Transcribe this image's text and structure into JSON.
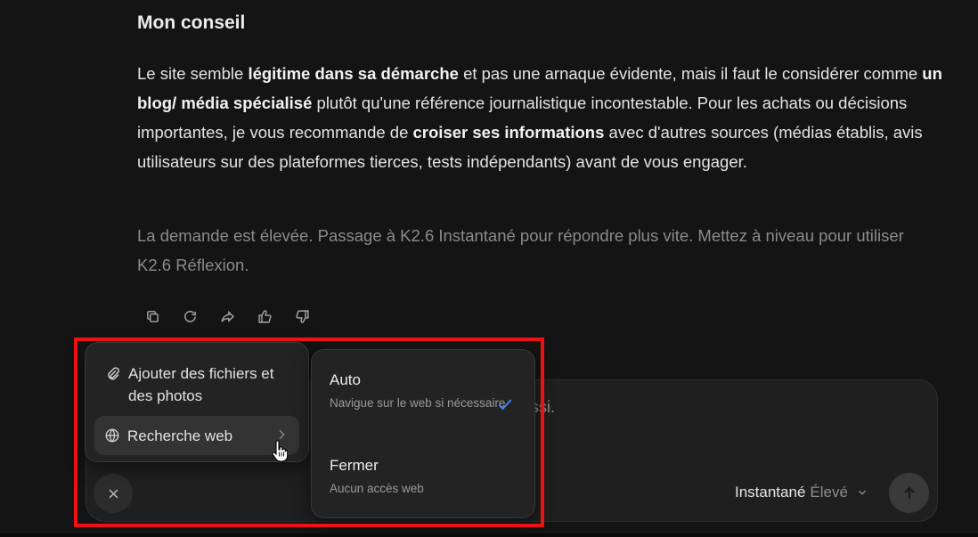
{
  "response": {
    "heading": "Mon conseil",
    "paragraph": [
      {
        "t": "Le site semble ",
        "b": false
      },
      {
        "t": "légitime dans sa démarche",
        "b": true
      },
      {
        "t": " et pas une arnaque évidente, mais il faut le considérer comme ",
        "b": false
      },
      {
        "t": "un blog/ média spécialisé",
        "b": true
      },
      {
        "t": " plutôt qu'une référence journalistique incontestable. Pour les achats ou décisions importantes, je vous recommande de ",
        "b": false
      },
      {
        "t": "croiser ses informations",
        "b": true
      },
      {
        "t": " avec d'autres sources (médias établis, avis utilisateurs sur des plateformes tierces, tests indépendants) avant de vous engager.",
        "b": false
      }
    ],
    "notice": "La demande est élevée. Passage à K2.6 Instantané pour répondre plus vite. Mettez à niveau pour utiliser K2.6 Réflexion."
  },
  "actions": [
    "copy-icon",
    "regenerate-icon",
    "share-icon",
    "thumbs-up-icon",
    "thumbs-down-icon"
  ],
  "input": {
    "visible_text": "ssi.",
    "model_name": "Instantané",
    "model_level": "Élevé"
  },
  "attach_menu": {
    "files_label": "Ajouter des fichiers et des photos",
    "web_label": "Recherche web"
  },
  "web_submenu": {
    "options": [
      {
        "title": "Auto",
        "desc": "Navigue sur le web si nécessaire",
        "selected": true
      },
      {
        "title": "Fermer",
        "desc": "Aucun accès web",
        "selected": false
      }
    ]
  },
  "colors": {
    "highlight": "#ee1111",
    "check": "#3b8cf5",
    "background": "#141414"
  }
}
